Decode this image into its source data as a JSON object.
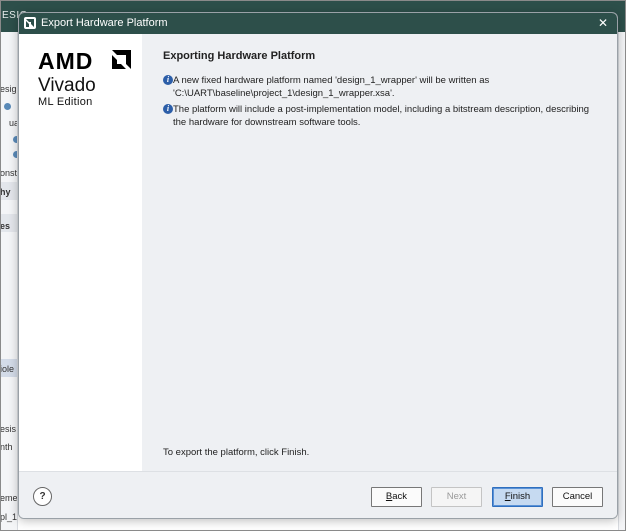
{
  "background": {
    "title_fragment": "ESIG",
    "left_fragments": [
      "esig",
      "ua",
      "onst",
      "hy",
      "es",
      "iole",
      "esis",
      "nth",
      "eme",
      "pl_1"
    ]
  },
  "dialog": {
    "title": "Export Hardware Platform",
    "close_glyph": "✕",
    "brand": {
      "logo": "AMD",
      "product": "Vivado",
      "edition": "ML Edition"
    },
    "heading": "Exporting Hardware Platform",
    "info_items": [
      {
        "line1": "A new fixed hardware platform named 'design_1_wrapper' will be written as",
        "line2": "'C:\\UART\\baseline\\project_1\\design_1_wrapper.xsa'."
      },
      {
        "line1": "The platform will include a post-implementation model, including a bitstream description, describing",
        "line2": "the hardware for downstream software tools."
      }
    ],
    "footer_note": "To export the platform, click Finish.",
    "buttons": {
      "help": "?",
      "back_prefix": "",
      "back_underlined": "B",
      "back_rest": "ack",
      "next": "Next",
      "finish_underlined": "F",
      "finish_rest": "inish",
      "cancel": "Cancel"
    }
  },
  "colors": {
    "titlebar": "#2d4f4a",
    "content_bg": "#eef0f3",
    "finish_bg": "#c6daf1",
    "finish_border": "#2f6fbf",
    "info_icon": "#2c5ea8"
  }
}
